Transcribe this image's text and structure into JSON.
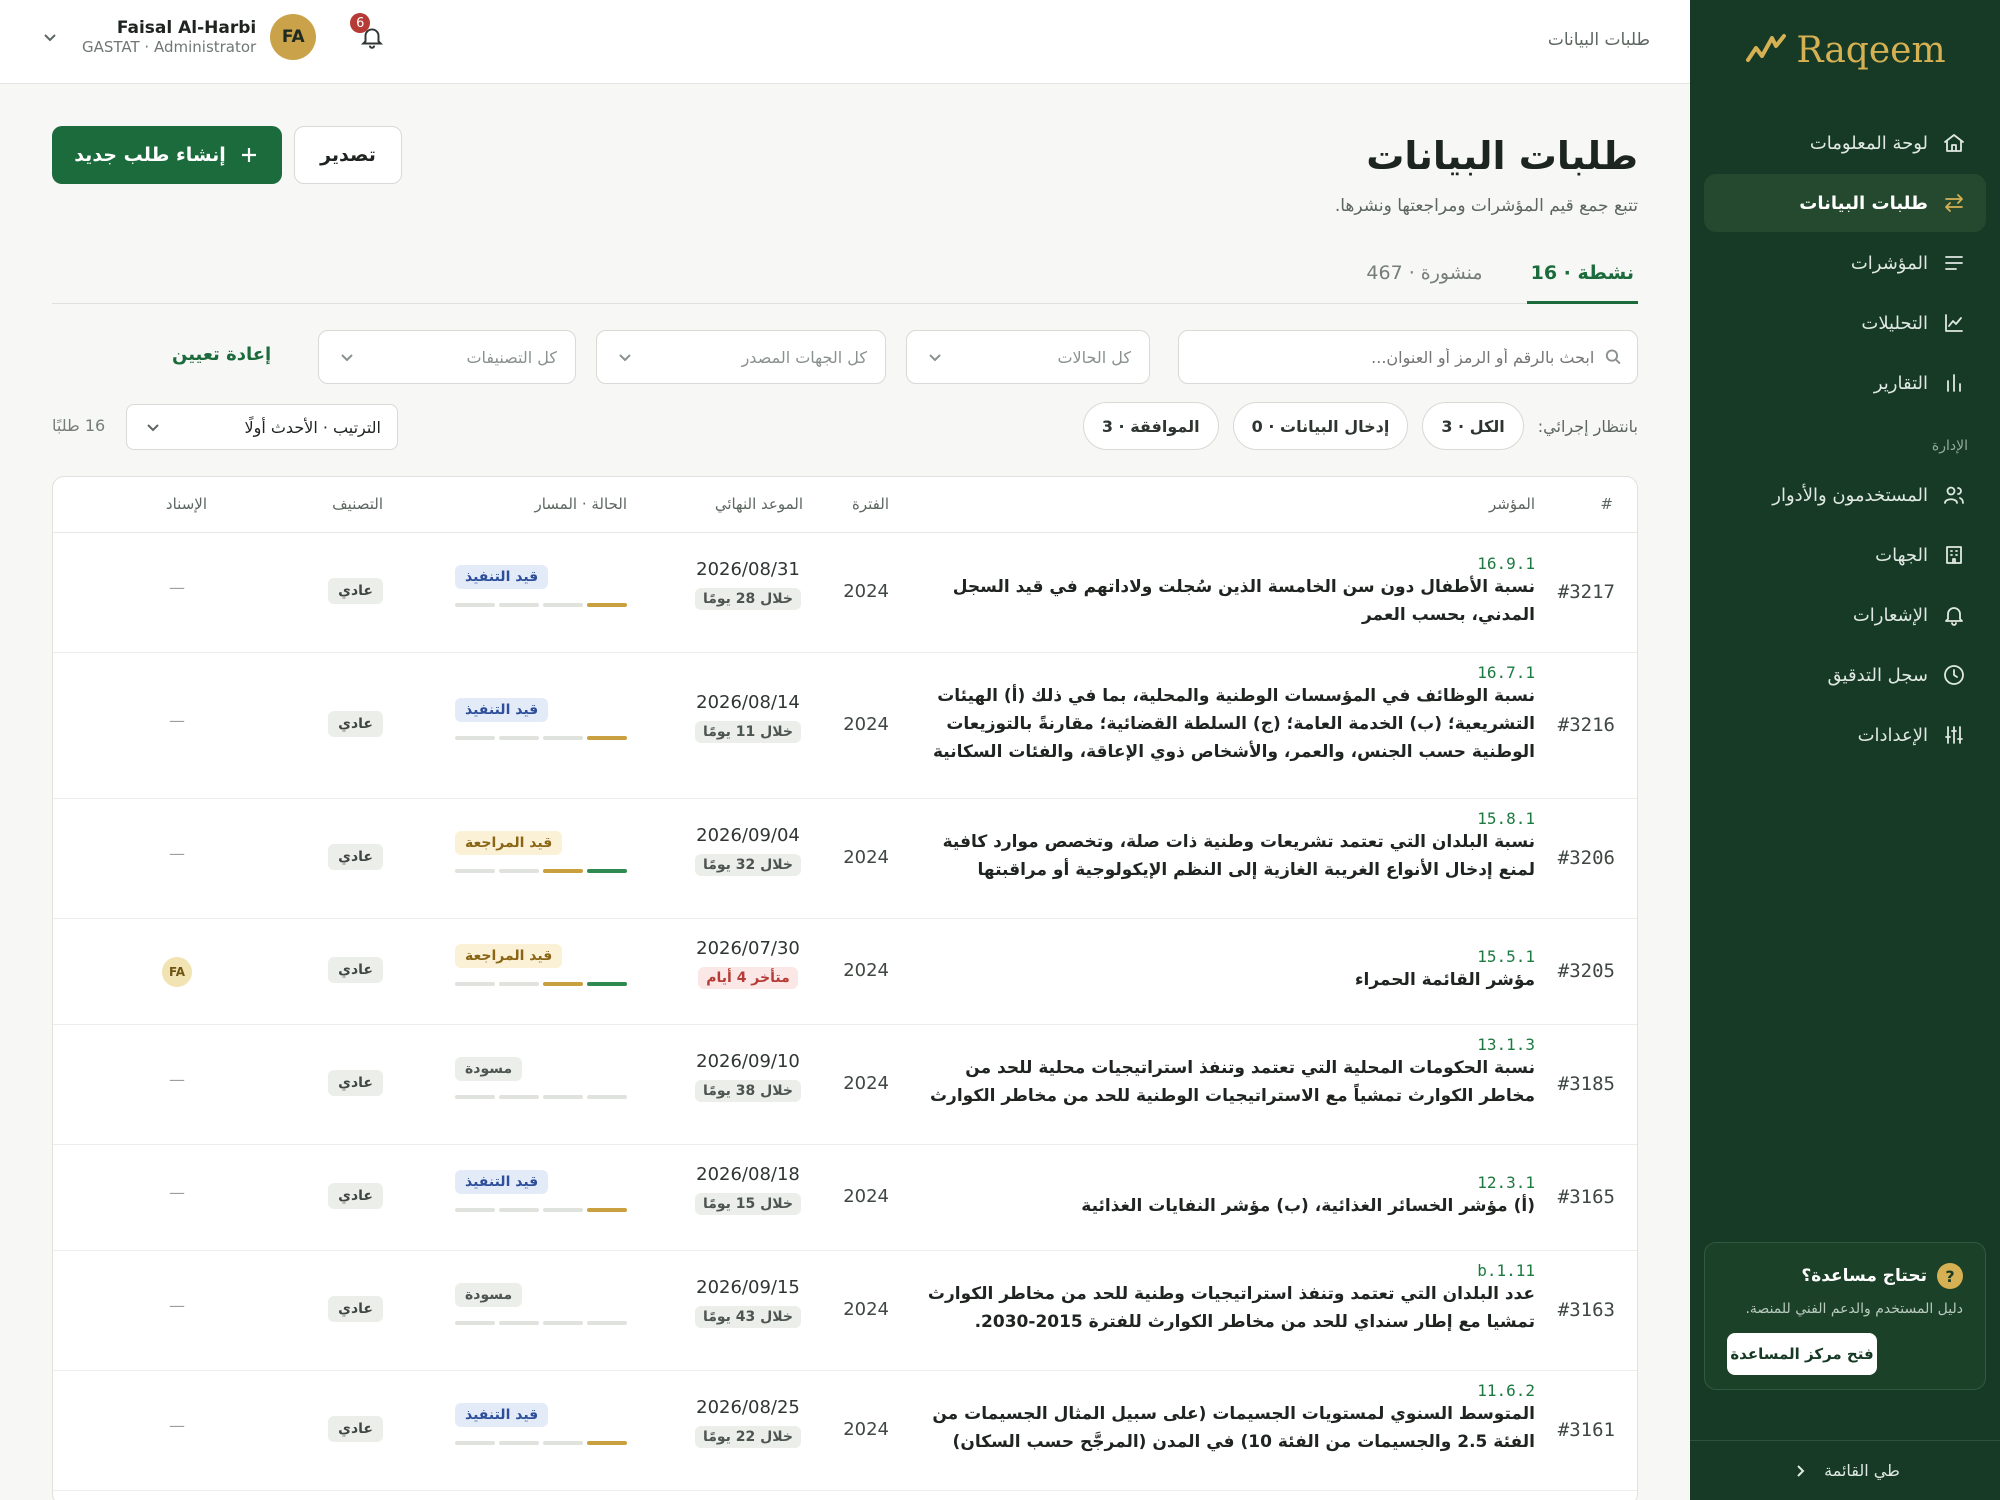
{
  "app": {
    "brand": "Raqeem",
    "breadcrumb": "طلبات البيانات"
  },
  "user": {
    "name": "Faisal Al-Harbi",
    "role": "GASTAT · Administrator",
    "initials": "FA",
    "notifications": "6"
  },
  "sidebar": {
    "items": [
      {
        "label": "لوحة المعلومات",
        "icon": "home-icon"
      },
      {
        "label": "طلبات البيانات",
        "icon": "arrows-exchange-icon",
        "active": true
      },
      {
        "label": "المؤشرات",
        "icon": "list-lines-icon"
      },
      {
        "label": "التحليلات",
        "icon": "line-chart-icon"
      },
      {
        "label": "التقارير",
        "icon": "bar-chart-icon"
      }
    ],
    "admin_section": "الإدارة",
    "admin_items": [
      {
        "label": "المستخدمون والأدوار",
        "icon": "users-icon"
      },
      {
        "label": "الجهات",
        "icon": "building-icon"
      },
      {
        "label": "الإشعارات",
        "icon": "bell-icon"
      },
      {
        "label": "سجل التدقيق",
        "icon": "clock-icon"
      },
      {
        "label": "الإعدادات",
        "icon": "sliders-icon"
      }
    ],
    "help": {
      "title": "تحتاج مساعدة؟",
      "subtitle": "دليل المستخدم والدعم الفني للمنصة.",
      "button": "فتح مركز المساعدة"
    },
    "collapse_label": "طي القائمة"
  },
  "page": {
    "title": "طلبات البيانات",
    "subtitle": "تتبع جمع قيم المؤشرات ومراجعتها ونشرها.",
    "create_button": "إنشاء طلب جديد",
    "export_button": "تصدير"
  },
  "tabs": [
    {
      "label": "نشطة · 16",
      "active": true
    },
    {
      "label": "منشورة · 467",
      "active": false
    }
  ],
  "filters": {
    "search_placeholder": "ابحث بالرقم أو الرمز أو العنوان...",
    "status": "كل الحالات",
    "source": "كل الجهات المصدر",
    "classification": "كل التصنيفات",
    "reset": "إعادة تعيين"
  },
  "quick": {
    "label": "بانتظار إجرائي:",
    "chips": [
      "الكل · 3",
      "إدخال البيانات · 0",
      "الموافقة · 3"
    ]
  },
  "sort": "الترتيب · الأحدث أولًا",
  "count": "16 طلبًا",
  "table": {
    "headers": {
      "num": "#",
      "indicator": "المؤشر",
      "period": "الفترة",
      "deadline": "الموعد النهائي",
      "status": "الحالة · المسار",
      "classification": "التصنيف",
      "assignee": "الإسناد"
    },
    "rows": [
      {
        "id": "#3217",
        "code": "16.9.1",
        "name": "نسبة الأطفال دون سن الخامسة الذين سُجلت ولاداتهم في قيد السجل المدني، بحسب العمر",
        "period": "2024",
        "deadline": "2026/08/31",
        "days": "خلال 28 يومًا",
        "late": false,
        "status": "قيد التنفيذ",
        "status_kind": "exec",
        "progress": [
          0,
          0,
          0,
          1
        ],
        "classification": "عادي",
        "assignee": "—"
      },
      {
        "id": "#3216",
        "code": "16.7.1",
        "name": "نسبة الوظائف في المؤسسات الوطنية والمحلية، بما في ذلك (أ) الهيئات التشريعية؛ (ب) الخدمة العامة؛ (ج) السلطة القضائية؛ مقارنةً بالتوزيعات الوطنية حسب الجنس، والعمر، والأشخاص ذوي الإعاقة، والفئات السكانية",
        "period": "2024",
        "deadline": "2026/08/14",
        "days": "خلال 11 يومًا",
        "late": false,
        "status": "قيد التنفيذ",
        "status_kind": "exec",
        "progress": [
          0,
          0,
          0,
          1
        ],
        "classification": "عادي",
        "assignee": "—"
      },
      {
        "id": "#3206",
        "code": "15.8.1",
        "name": "نسبة البلدان التي تعتمد تشريعات وطنية ذات صلة، وتخصص موارد كافية لمنع إدخال الأنواع الغريبة الغازية إلى النظم الإيكولوجية أو مراقبتها",
        "period": "2024",
        "deadline": "2026/09/04",
        "days": "خلال 32 يومًا",
        "late": false,
        "status": "قيد المراجعة",
        "status_kind": "review",
        "progress": [
          0,
          0,
          1,
          2
        ],
        "classification": "عادي",
        "assignee": "—"
      },
      {
        "id": "#3205",
        "code": "15.5.1",
        "name": "مؤشر القائمة الحمراء",
        "period": "2024",
        "deadline": "2026/07/30",
        "days": "متأخر 4 أيام",
        "late": true,
        "status": "قيد المراجعة",
        "status_kind": "review",
        "progress": [
          0,
          0,
          1,
          2
        ],
        "classification": "عادي",
        "assignee": "FA"
      },
      {
        "id": "#3185",
        "code": "13.1.3",
        "name": "نسبة الحكومات المحلية التي تعتمد وتنفذ استراتيجيات محلية للحد من مخاطر الكوارث تمشياً مع الاستراتيجيات الوطنية للحد من مخاطر الكوارث",
        "period": "2024",
        "deadline": "2026/09/10",
        "days": "خلال 38 يومًا",
        "late": false,
        "status": "مسودة",
        "status_kind": "draft",
        "progress": [
          0,
          0,
          0,
          0
        ],
        "classification": "عادي",
        "assignee": "—"
      },
      {
        "id": "#3165",
        "code": "12.3.1",
        "name": "(أ) مؤشر الخسائر الغذائية، (ب) مؤشر النفايات الغذائية",
        "period": "2024",
        "deadline": "2026/08/18",
        "days": "خلال 15 يومًا",
        "late": false,
        "status": "قيد التنفيذ",
        "status_kind": "exec",
        "progress": [
          0,
          0,
          0,
          1
        ],
        "classification": "عادي",
        "assignee": "—"
      },
      {
        "id": "#3163",
        "code": "11.b.1",
        "name": "عدد البلدان التي تعتمد وتنفذ استراتيجيات وطنية للحد من مخاطر الكوارث تمشيا مع إطار سنداي للحد من مخاطر الكوارث للفترة 2015-2030.",
        "period": "2024",
        "deadline": "2026/09/15",
        "days": "خلال 43 يومًا",
        "late": false,
        "status": "مسودة",
        "status_kind": "draft",
        "progress": [
          0,
          0,
          0,
          0
        ],
        "classification": "عادي",
        "assignee": "—"
      },
      {
        "id": "#3161",
        "code": "11.6.2",
        "name": "المتوسط السنوي لمستويات الجسيمات (على سبيل المثال الجسيمات من الفئة 2.5 والجسيمات من الفئة 10) في المدن (المرجَّح حسب السكان)",
        "period": "2024",
        "deadline": "2026/08/25",
        "days": "خلال 22 يومًا",
        "late": false,
        "status": "قيد التنفيذ",
        "status_kind": "exec",
        "progress": [
          0,
          0,
          0,
          1
        ],
        "classification": "عادي",
        "assignee": "—"
      }
    ]
  }
}
